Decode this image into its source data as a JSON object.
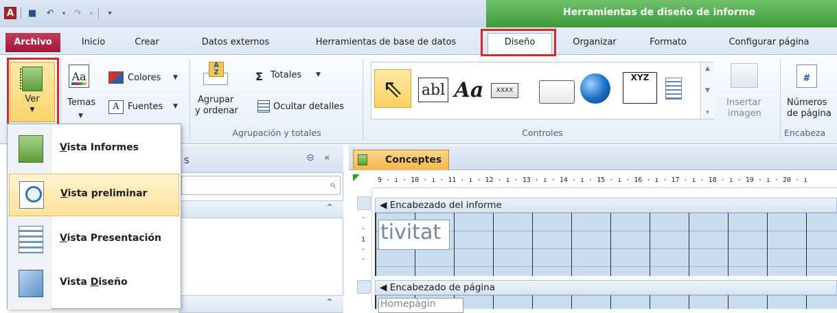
{
  "title_bar": {
    "app_icon_letter": "A",
    "context_title": "Herramientas de diseño de informe"
  },
  "tabs": [
    {
      "label": "Archivo"
    },
    {
      "label": "Inicio"
    },
    {
      "label": "Crear"
    },
    {
      "label": "Datos externos"
    },
    {
      "label": "Herramientas de base de datos"
    },
    {
      "label": "Diseño"
    },
    {
      "label": "Organizar"
    },
    {
      "label": "Formato"
    },
    {
      "label": "Configurar página"
    }
  ],
  "ribbon": {
    "ver_label": "Ver",
    "temas_label": "Temas",
    "colores_label": "Colores",
    "fuentes_label": "Fuentes",
    "agrupar_label_1": "Agrupar",
    "agrupar_label_2": "y ordenar",
    "totales_label": "Totales",
    "ocultar_label": "Ocultar detalles",
    "group_agrupacion": "Agrupación y totales",
    "group_controles": "Controles",
    "insertar_label_1": "Insertar",
    "insertar_label_2": "imagen",
    "numeros_label_1": "Números",
    "numeros_label_2": "de página",
    "group_encabezado": "Encabeza",
    "gallery_abl": "abl",
    "gallery_aa": "Aa",
    "gallery_xxxx": "XXXX",
    "gallery_xyz": "XYZ",
    "numeros_icon_glyph": "#"
  },
  "view_menu": {
    "items": [
      {
        "label": "Vista Informes",
        "underline": "V",
        "rest": "ista Informes"
      },
      {
        "label": "Vista preliminar",
        "underline": "V",
        "rest": "ista preliminar"
      },
      {
        "label": "Vista Presentación",
        "underline": "V",
        "rest": "ista Presentación"
      },
      {
        "label": "Vista Diseño",
        "prefix": "Vista ",
        "underline": "D",
        "rest": "iseño"
      }
    ]
  },
  "nav_pane": {
    "header_fragment": "s"
  },
  "document": {
    "tab_label": "Conceptes",
    "ruler_text": "9 · ı · 10 · ı · 11 · ı · 12 · ı · 13 · ı · 14 · ı · 15 · ı · 16 · ı · 17 · ı · 18 · ı · 19 · ı · 20 · ı",
    "ruler_v_mark": "1",
    "section_report_header": "Encabezado del informe",
    "section_page_header": "Encabezado de página",
    "label_tivitat": "tivitat",
    "label_partial": "Homepàgin"
  },
  "highlights": [
    "ver-button",
    "tab-diseno",
    "menu-item-vista-preliminar"
  ]
}
